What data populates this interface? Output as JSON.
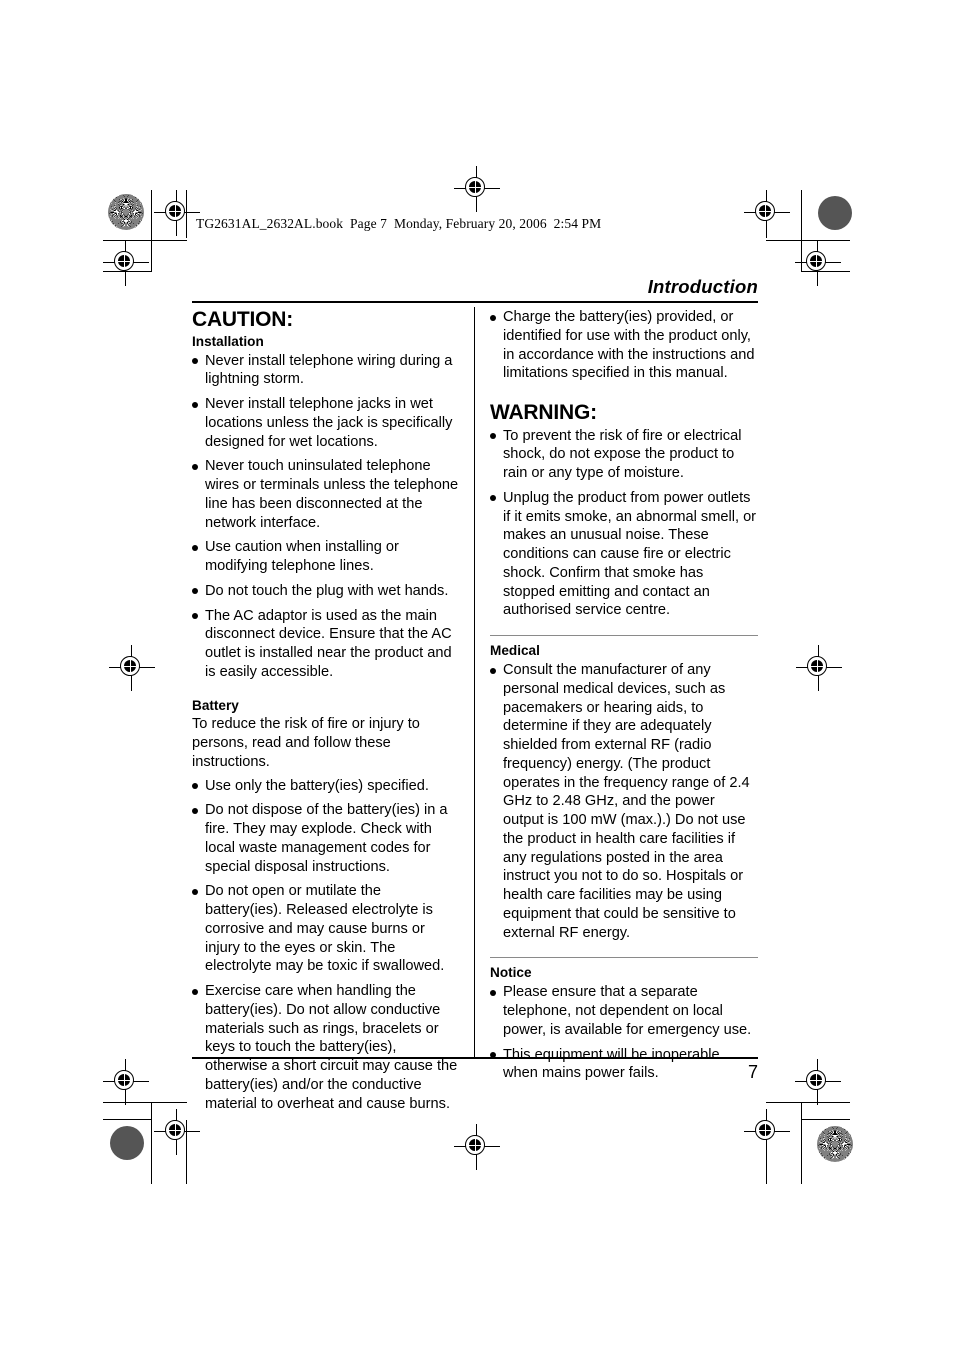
{
  "book_header": "TG2631AL_2632AL.book  Page 7  Monday, February 20, 2006  2:54 PM",
  "running_head": "Introduction",
  "page_number": "7",
  "left_column": {
    "caution_heading": "CAUTION:",
    "installation_heading": "Installation",
    "installation_items": [
      "Never install telephone wiring during a lightning storm.",
      "Never install telephone jacks in wet locations unless the jack is specifically designed for wet locations.",
      "Never touch uninsulated telephone wires or terminals unless the telephone line has been disconnected at the network interface.",
      "Use caution when installing or modifying telephone lines.",
      "Do not touch the plug with wet hands.",
      "The AC adaptor is used as the main disconnect device. Ensure that the AC outlet is installed near the product and is easily accessible."
    ],
    "battery_heading": "Battery",
    "battery_lead": "To reduce the risk of fire or injury to persons, read and follow these instructions.",
    "battery_items": [
      "Use only the battery(ies) specified.",
      "Do not dispose of the battery(ies) in a fire. They may explode. Check with local waste management codes for special disposal instructions.",
      "Do not open or mutilate the battery(ies). Released electrolyte is corrosive and may cause burns or injury to the eyes or skin. The electrolyte may be toxic if swallowed.",
      "Exercise care when handling the battery(ies). Do not allow conductive materials such as rings, bracelets or keys to touch the battery(ies), otherwise a short circuit may cause the battery(ies) and/or the conductive material to overheat and cause burns."
    ]
  },
  "right_column": {
    "battery_continued_items": [
      "Charge the battery(ies) provided, or identified for use with the product only, in accordance with the instructions and limitations specified in this manual."
    ],
    "warning_heading": "WARNING:",
    "warning_items": [
      "To prevent the risk of fire or electrical shock, do not expose the product to rain or any type of moisture.",
      "Unplug the product from power outlets if it emits smoke, an abnormal smell, or makes an unusual noise. These conditions can cause fire or electric shock. Confirm that smoke has stopped emitting and contact an authorised service centre."
    ],
    "medical_heading": "Medical",
    "medical_items": [
      "Consult the manufacturer of any personal medical devices, such as pacemakers or hearing aids, to determine if they are adequately shielded from external RF (radio frequency) energy. (The product operates in the frequency range of 2.4 GHz to 2.48 GHz, and the power output is 100 mW (max.).) Do not use the product in health care facilities if any regulations posted in the area instruct you not to do so. Hospitals or health care facilities may be using equipment that could be sensitive to external RF energy."
    ],
    "notice_heading": "Notice",
    "notice_items": [
      "Please ensure that a separate telephone, not dependent on local power, is available for emergency use.",
      "This equipment will be inoperable when mains power fails."
    ]
  }
}
